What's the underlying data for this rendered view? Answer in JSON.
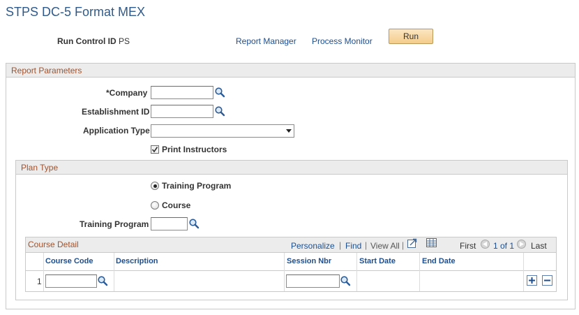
{
  "page": {
    "title": "STPS DC-5 Format MEX"
  },
  "header": {
    "run_control_label": "Run Control ID",
    "run_control_value": "PS",
    "report_manager": "Report Manager",
    "process_monitor": "Process Monitor",
    "run_button": "Run"
  },
  "report_parameters": {
    "title": "Report Parameters",
    "company_label": "*Company",
    "company_value": "",
    "establishment_label": "Establishment ID",
    "establishment_value": "",
    "application_type_label": "Application Type",
    "application_type_value": "",
    "print_instructors_label": "Print Instructors",
    "print_instructors_checked": true
  },
  "plan_type": {
    "title": "Plan Type",
    "options": [
      "Training Program",
      "Course"
    ],
    "selected": "Training Program",
    "training_program_label": "Training Program",
    "training_program_value": ""
  },
  "course_detail": {
    "title": "Course Detail",
    "personalize": "Personalize",
    "find": "Find",
    "view_all": "View All",
    "first": "First",
    "range": "1 of 1",
    "last": "Last",
    "columns": [
      "Course Code",
      "Description",
      "Session Nbr",
      "Start Date",
      "End Date"
    ],
    "rows": [
      {
        "row_number": "1",
        "course_code": "",
        "description": "",
        "session_nbr": "",
        "start_date": "",
        "end_date": ""
      }
    ]
  },
  "colors": {
    "title_blue": "#2f5b8c",
    "link_blue": "#1d4e8f",
    "section_title": "#a0522d",
    "run_button": "#f5cd8a"
  },
  "icons": [
    "lookup-icon",
    "dropdown-arrow-icon",
    "checkmark-icon",
    "download-icon",
    "grid-view-icon",
    "prev-arrow-icon",
    "next-arrow-icon",
    "add-row-icon",
    "delete-row-icon"
  ]
}
